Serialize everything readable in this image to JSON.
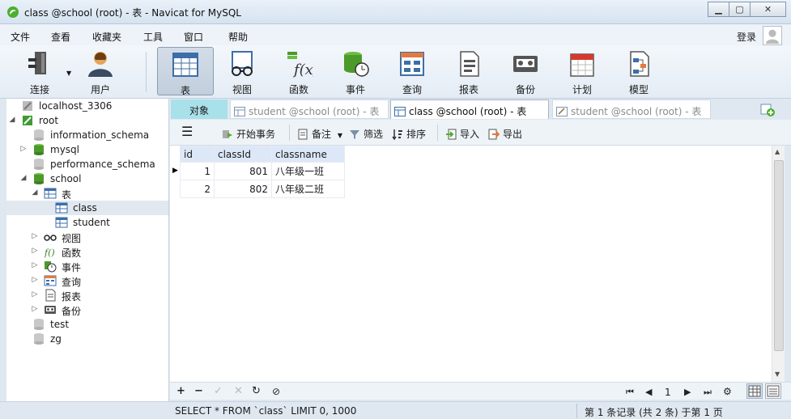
{
  "window": {
    "title": "class @school (root) - 表 - Navicat for MySQL"
  },
  "menu": {
    "items": [
      "文件",
      "查看",
      "收藏夹",
      "工具",
      "窗口",
      "帮助"
    ],
    "login": "登录"
  },
  "toolbar": {
    "buttons": [
      {
        "label": "连接",
        "icon": "plug-icon"
      },
      {
        "label": "用户",
        "icon": "user-icon"
      },
      {
        "label": "表",
        "icon": "table-icon"
      },
      {
        "label": "视图",
        "icon": "view-icon"
      },
      {
        "label": "函数",
        "icon": "function-icon"
      },
      {
        "label": "事件",
        "icon": "event-icon"
      },
      {
        "label": "查询",
        "icon": "query-icon"
      },
      {
        "label": "报表",
        "icon": "report-icon"
      },
      {
        "label": "备份",
        "icon": "backup-icon"
      },
      {
        "label": "计划",
        "icon": "schedule-icon"
      },
      {
        "label": "模型",
        "icon": "model-icon"
      }
    ]
  },
  "tree": {
    "nodes": [
      {
        "label": "localhost_3306",
        "icon": "connection-icon"
      },
      {
        "label": "root",
        "icon": "connection-open-icon"
      },
      {
        "label": "information_schema",
        "icon": "database-icon"
      },
      {
        "label": "mysql",
        "icon": "database-icon"
      },
      {
        "label": "performance_schema",
        "icon": "database-icon"
      },
      {
        "label": "school",
        "icon": "database-open-icon"
      },
      {
        "label": "表",
        "icon": "tables-icon"
      },
      {
        "label": "class",
        "icon": "table-icon"
      },
      {
        "label": "student",
        "icon": "table-icon"
      },
      {
        "label": "视图",
        "icon": "view-icon"
      },
      {
        "label": "函数",
        "icon": "function-icon"
      },
      {
        "label": "事件",
        "icon": "event-icon"
      },
      {
        "label": "查询",
        "icon": "query-icon"
      },
      {
        "label": "报表",
        "icon": "report-icon"
      },
      {
        "label": "备份",
        "icon": "backup-icon"
      },
      {
        "label": "test",
        "icon": "database-closed-icon"
      },
      {
        "label": "zg",
        "icon": "database-closed-icon"
      }
    ]
  },
  "tabs": {
    "objects": "对象",
    "items": [
      {
        "label": "student @school (root) - 表"
      },
      {
        "label": "class @school (root) - 表"
      },
      {
        "label": "student @school (root) - 表"
      }
    ]
  },
  "objbar": {
    "begin_txn": "开始事务",
    "memo": "备注",
    "filter": "筛选",
    "sort": "排序",
    "import": "导入",
    "export": "导出"
  },
  "grid": {
    "columns": [
      "id",
      "classId",
      "classname"
    ],
    "rows": [
      [
        "1",
        "801",
        "八年级一班"
      ],
      [
        "2",
        "802",
        "八年级二班"
      ]
    ]
  },
  "pager": {
    "page": "1"
  },
  "status": {
    "sql": "SELECT * FROM `class` LIMIT 0, 1000",
    "records": "第 1 条记录 (共 2 条) 于第 1 页"
  },
  "colors": {
    "accent_tab": "#a9e1ea",
    "header_bg": "#dce8f8",
    "selected_row": "#e2e8ef"
  }
}
